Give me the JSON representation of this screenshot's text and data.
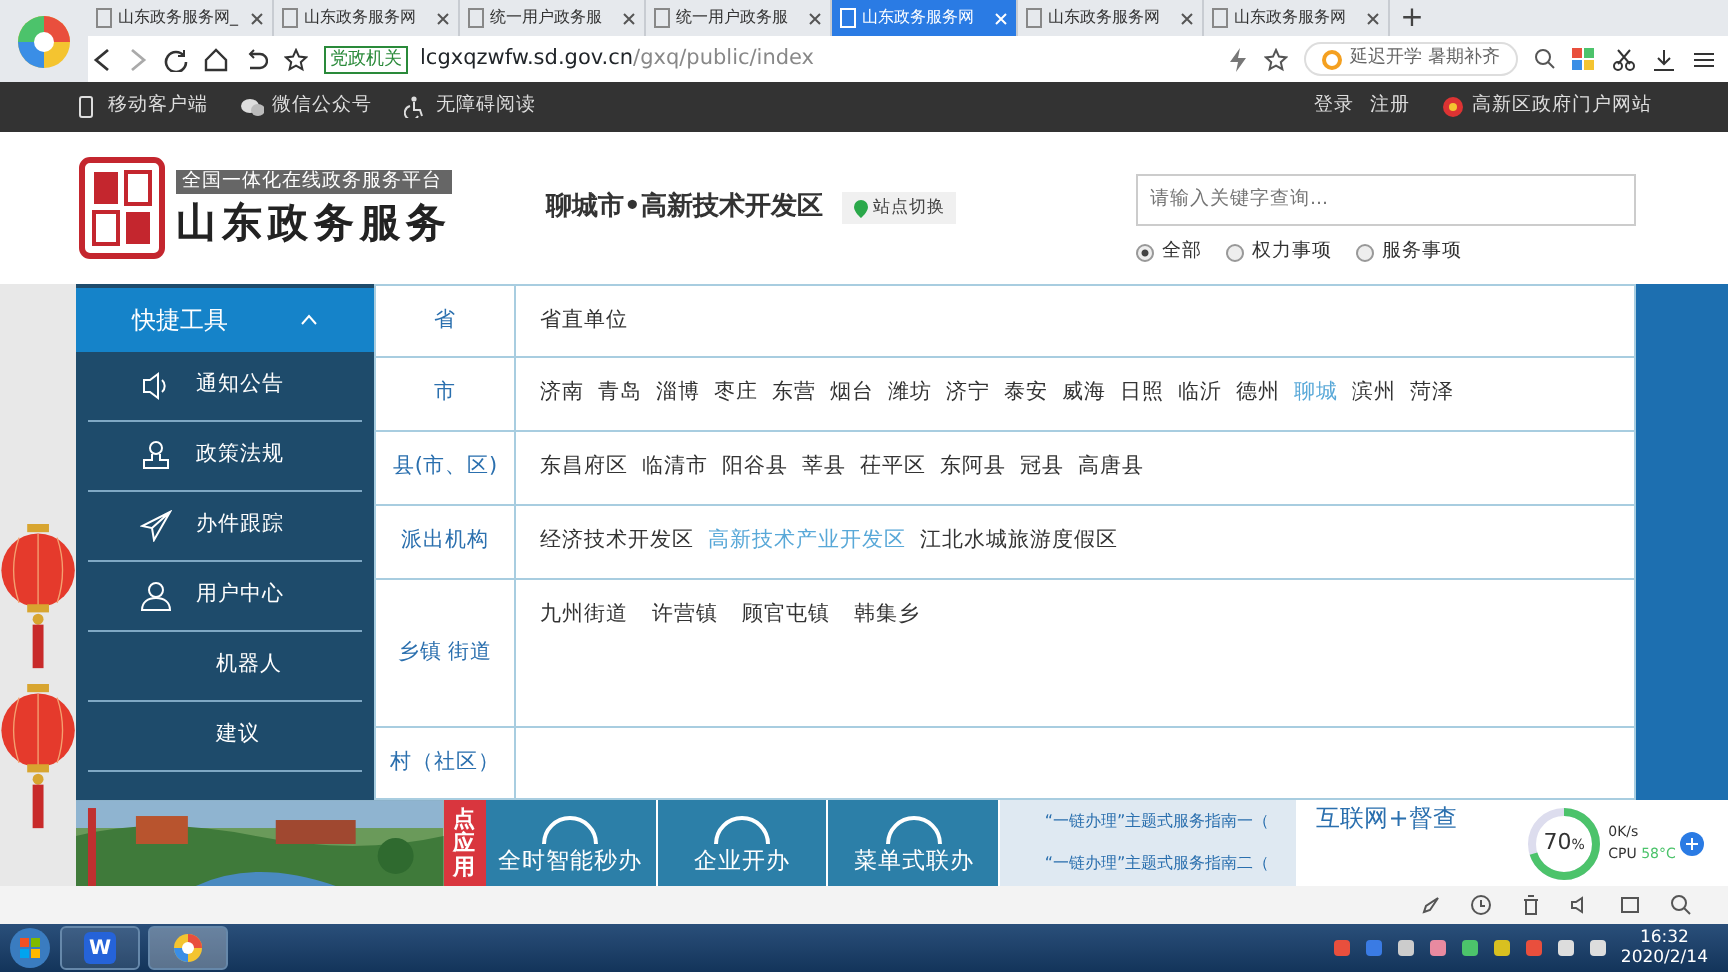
{
  "browser": {
    "tabs": [
      {
        "title": "山东政务服务网_",
        "selected": false
      },
      {
        "title": "山东政务服务网",
        "selected": false
      },
      {
        "title": "统一用户政务服",
        "selected": false
      },
      {
        "title": "统一用户政务服",
        "selected": false
      },
      {
        "title": "山东政务服务网",
        "selected": true
      },
      {
        "title": "山东政务服务网",
        "selected": false
      },
      {
        "title": "山东政务服务网",
        "selected": false
      }
    ],
    "new_tab": "+",
    "badge": "党政机关",
    "url_host": "lcgxqzwfw.sd.gov.cn",
    "url_path": "/gxq/public/index",
    "hot_search": "延迟开学 暑期补齐"
  },
  "top_bar": {
    "left": [
      {
        "kind": "phone",
        "label": "移动客户端"
      },
      {
        "kind": "wechat",
        "label": "微信公众号"
      },
      {
        "kind": "access",
        "label": "无障碍阅读"
      }
    ],
    "login": "登录",
    "register": "注册",
    "portal": "高新区政府门户网站"
  },
  "header": {
    "platform": "全国一体化在线政务服务平台",
    "site_name": "山东政务服务",
    "region": "聊城市•高新技术开发区",
    "switch": "站点切换",
    "search": {
      "placeholder": "请输入关键字查询..."
    },
    "scopes": [
      {
        "label": "全部",
        "selected": true
      },
      {
        "label": "权力事项",
        "selected": false
      },
      {
        "label": "服务事项",
        "selected": false
      }
    ]
  },
  "sidebar": {
    "title": "快捷工具",
    "expanded": true,
    "items": [
      {
        "kind": "speaker",
        "label": "通知公告"
      },
      {
        "kind": "stamp",
        "label": "政策法规"
      },
      {
        "kind": "plane",
        "label": "办件跟踪"
      },
      {
        "kind": "user",
        "label": "用户中心"
      },
      {
        "kind": "hidden",
        "label": "机器人"
      },
      {
        "kind": "hidden",
        "label": "建议"
      }
    ]
  },
  "region_picker": {
    "rows": [
      {
        "label": "省",
        "items": [
          {
            "text": "省直单位",
            "selected": false
          }
        ]
      },
      {
        "label": "市",
        "items": [
          {
            "text": "济南",
            "selected": false
          },
          {
            "text": "青岛",
            "selected": false
          },
          {
            "text": "淄博",
            "selected": false
          },
          {
            "text": "枣庄",
            "selected": false
          },
          {
            "text": "东营",
            "selected": false
          },
          {
            "text": "烟台",
            "selected": false
          },
          {
            "text": "潍坊",
            "selected": false
          },
          {
            "text": "济宁",
            "selected": false
          },
          {
            "text": "泰安",
            "selected": false
          },
          {
            "text": "威海",
            "selected": false
          },
          {
            "text": "日照",
            "selected": false
          },
          {
            "text": "临沂",
            "selected": false
          },
          {
            "text": "德州",
            "selected": false
          },
          {
            "text": "聊城",
            "selected": true
          },
          {
            "text": "滨州",
            "selected": false
          },
          {
            "text": "菏泽",
            "selected": false
          }
        ]
      },
      {
        "label": "县(市、区)",
        "items": [
          {
            "text": "东昌府区",
            "selected": false
          },
          {
            "text": "临清市",
            "selected": false
          },
          {
            "text": "阳谷县",
            "selected": false
          },
          {
            "text": "莘县",
            "selected": false
          },
          {
            "text": "茌平区",
            "selected": false
          },
          {
            "text": "东阿县",
            "selected": false
          },
          {
            "text": "冠县",
            "selected": false
          },
          {
            "text": "高唐县",
            "selected": false
          }
        ]
      },
      {
        "label": "派出机构",
        "items": [
          {
            "text": "经济技术开发区",
            "selected": false
          },
          {
            "text": "高新技术产业开发区",
            "selected": true
          },
          {
            "text": "江北水城旅游度假区",
            "selected": false
          }
        ]
      },
      {
        "label": "乡镇 街道",
        "items": [
          {
            "text": "九州街道",
            "selected": false
          },
          {
            "text": "许营镇",
            "selected": false
          },
          {
            "text": "顾官屯镇",
            "selected": false
          },
          {
            "text": "韩集乡",
            "selected": false
          }
        ]
      },
      {
        "label": "村（社区）",
        "items": []
      }
    ]
  },
  "quick_apps": {
    "tag": "点应用",
    "tiles": [
      "全时智能秒办",
      "企业开办",
      "菜单式联办"
    ]
  },
  "guides": [
    "“一链办理”主题式服务指南一（",
    "“一链办理”主题式服务指南二（"
  ],
  "banner": "互联网+督查",
  "monitor": {
    "usage": "70",
    "unit": "%",
    "level": 0.7,
    "net": "0K/s",
    "cpu_label": "CPU",
    "temp": "58°C"
  },
  "taskbar": {
    "apps": [
      {
        "kind": "wps",
        "label": "W",
        "selected": false
      },
      {
        "kind": "browser",
        "selected": true
      }
    ],
    "time": "16:32",
    "date": "2020/2/14"
  }
}
